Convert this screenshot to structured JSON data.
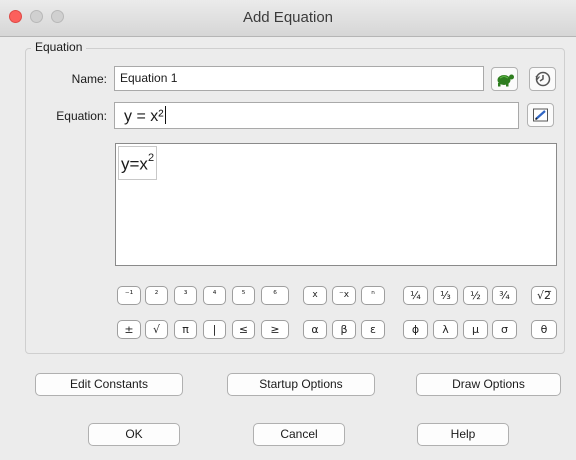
{
  "window": {
    "title": "Add Equation"
  },
  "group": {
    "legend": "Equation"
  },
  "name_row": {
    "label": "Name:",
    "value": "Equation 1"
  },
  "equation_row": {
    "label": "Equation:",
    "value": "y = x²"
  },
  "preview": {
    "base": "y=x",
    "exponent": "2"
  },
  "icons": {
    "name_icon_1": "turtle-icon",
    "name_icon_2": "history-clock-icon",
    "equation_icon": "edit-pencil-icon"
  },
  "symbols_row1": [
    "⁻¹",
    "²",
    "³",
    "⁴",
    "⁵",
    "⁶",
    "x",
    "⁻x",
    "ⁿ",
    "¼",
    "⅓",
    "½",
    "¾",
    "√2̅"
  ],
  "symbols_row2": [
    "±",
    "√",
    "π",
    "|",
    "≤",
    "≥",
    "α",
    "β",
    "ε",
    "ϕ",
    "λ",
    "μ",
    "σ",
    "θ"
  ],
  "buttons": {
    "edit_constants": "Edit Constants",
    "startup_options": "Startup Options",
    "draw_options": "Draw Options",
    "ok": "OK",
    "cancel": "Cancel",
    "help": "Help"
  },
  "colors": {
    "close_light": "#fc605c",
    "turtle_green": "#2e7d1f",
    "background": "#ececec"
  }
}
